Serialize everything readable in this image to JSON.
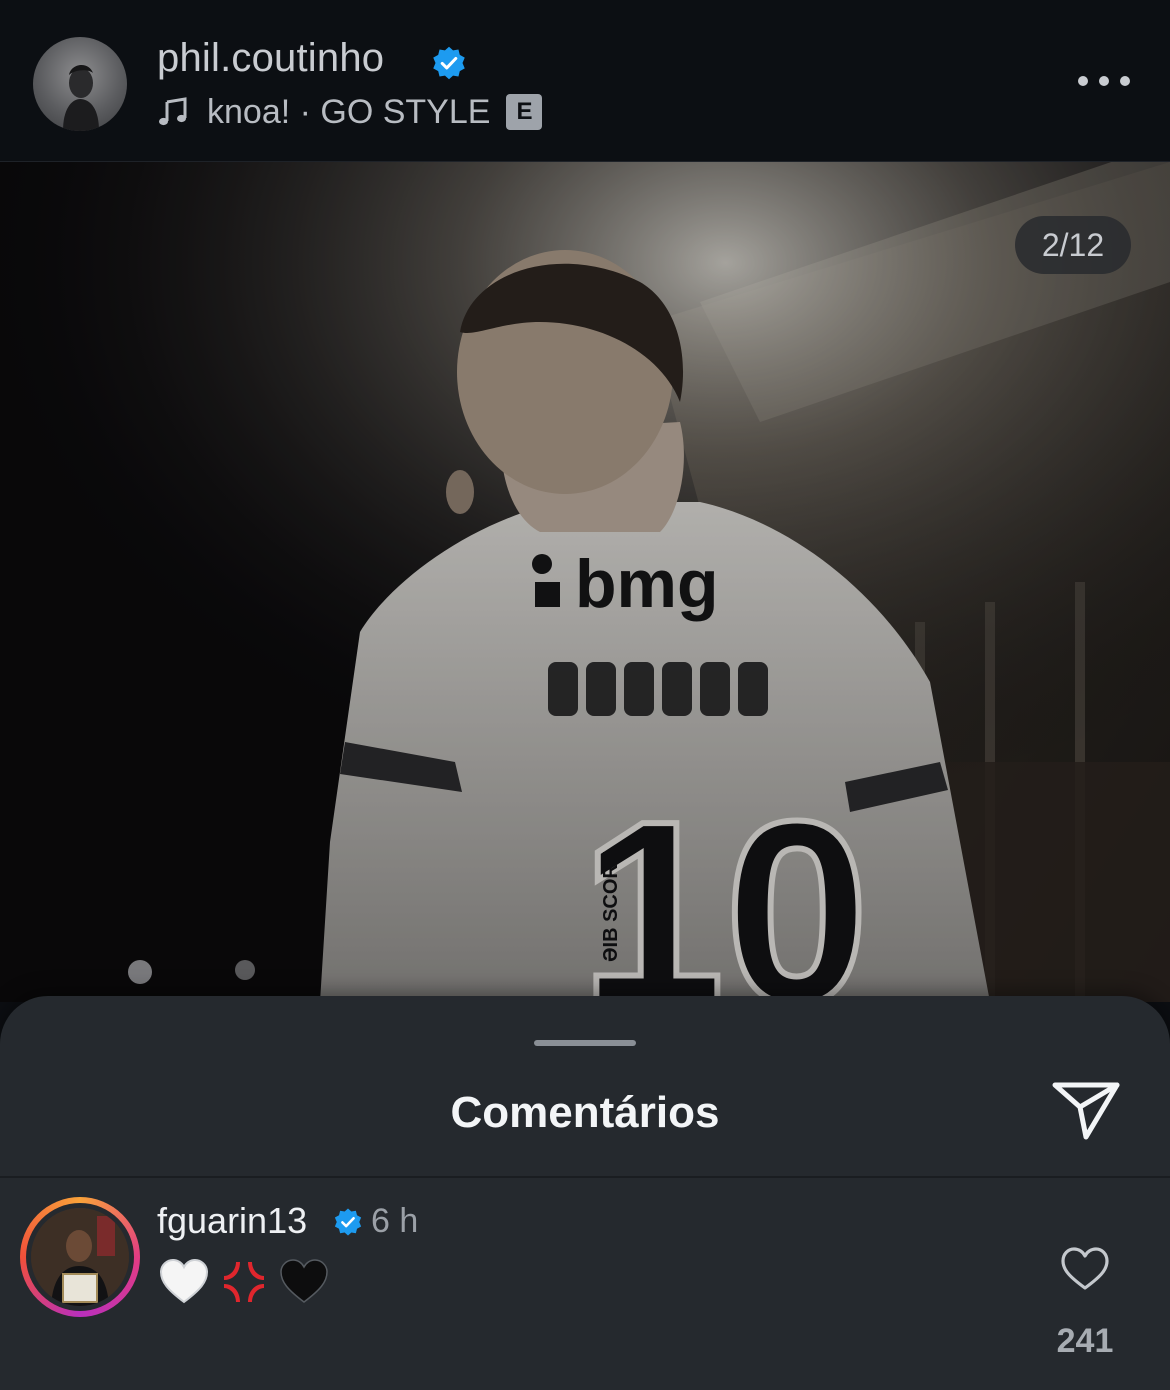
{
  "post_header": {
    "username": "phil.coutinho",
    "music_title": "knoa! · GO STYLE",
    "explicit_badge": "E"
  },
  "media": {
    "counter": "2/12",
    "jersey_sponsor": "bmg",
    "jersey_number": "10",
    "jersey_sleeve_text": "ƏIB SCORE"
  },
  "comments_sheet": {
    "title": "Comentários"
  },
  "comments": [
    {
      "username": "fguarin13",
      "time": "6 h",
      "likes": "241",
      "emojis": [
        "white-heart",
        "anger-symbol",
        "black-heart"
      ]
    }
  ],
  "colors": {
    "verified_blue": "#1d9bf0",
    "background": "#0c0e12",
    "sheet": "#25292e"
  }
}
